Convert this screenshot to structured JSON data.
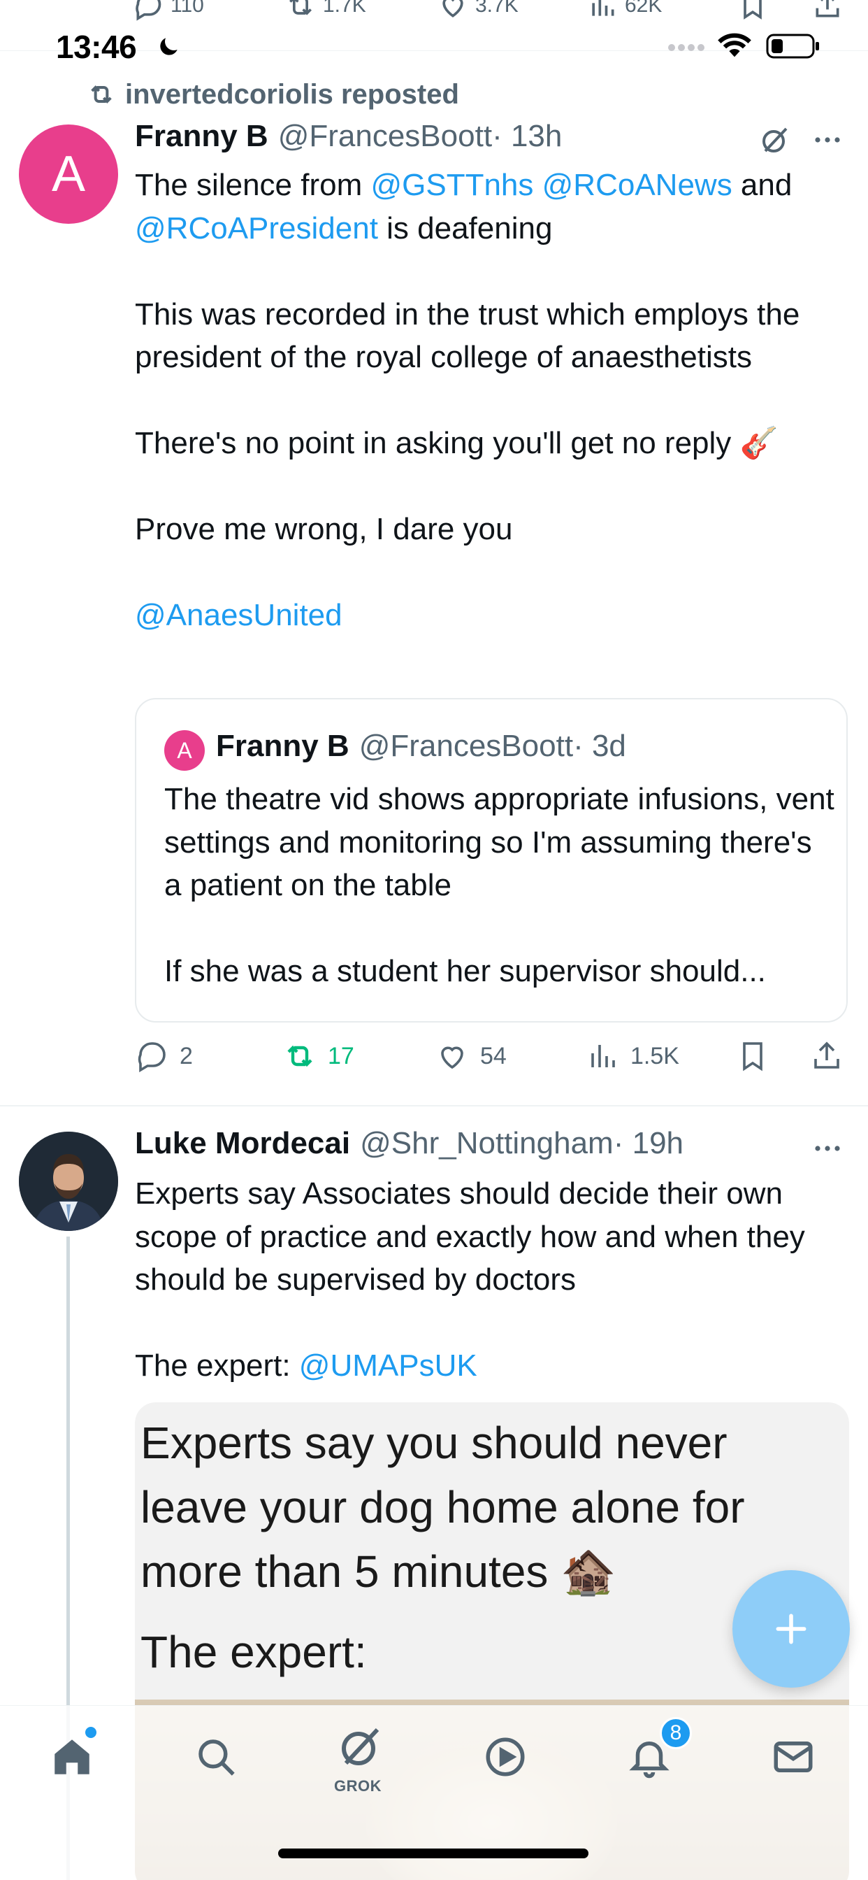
{
  "top_actions": {
    "replies": "110",
    "reposts": "1.7K",
    "likes": "3.7K",
    "views": "62K"
  },
  "status_bar": {
    "time": "13:46"
  },
  "repost": {
    "label": "invertedcoriolis reposted"
  },
  "tweet1": {
    "avatar_letter": "A",
    "name": "Franny B",
    "handle": "@FrancesBoott",
    "time": "· 13h",
    "line1_pre": "The silence from ",
    "mention1": "@GSTTnhs",
    "mention2": "@RCoANews",
    "line1_and": " and",
    "mention3": "@RCoAPresident",
    "line1_post": " is deafening",
    "para2": "This was recorded in the trust which employs the president of the royal college of anaesthetists",
    "para3": "There's no point in asking you'll get no reply 🎸",
    "para4": "Prove me wrong, I dare you",
    "mention4": "@AnaesUnited",
    "quote": {
      "avatar_letter": "A",
      "name": "Franny B",
      "handle": "@FrancesBoott",
      "time": "· 3d",
      "para1": "The theatre vid shows appropriate infusions, vent settings and monitoring so I'm assuming there's a patient on the table",
      "para2": "If she was a student her supervisor should..."
    },
    "actions": {
      "replies": "2",
      "reposts": "17",
      "likes": "54",
      "views": "1.5K"
    }
  },
  "tweet2": {
    "name": "Luke Mordecai",
    "handle": "@Shr_Nottingham",
    "time": "· 19h",
    "para1": "Experts say Associates should decide their own scope of practice and exactly how and when they should be supervised by doctors",
    "para2_pre": "The expert: ",
    "mention": "@UMAPsUK",
    "meme_text": "Experts say you should never leave your dog home alone for more than 5 minutes 🏚️",
    "meme_expert": "The expert:"
  },
  "nav": {
    "grok_label": "GROK",
    "notifications_count": "8"
  },
  "colors": {
    "accent": "#1d9bf0",
    "repost_green": "#00ba7c",
    "avatar_pink": "#e83e8c",
    "muted": "#536471"
  }
}
